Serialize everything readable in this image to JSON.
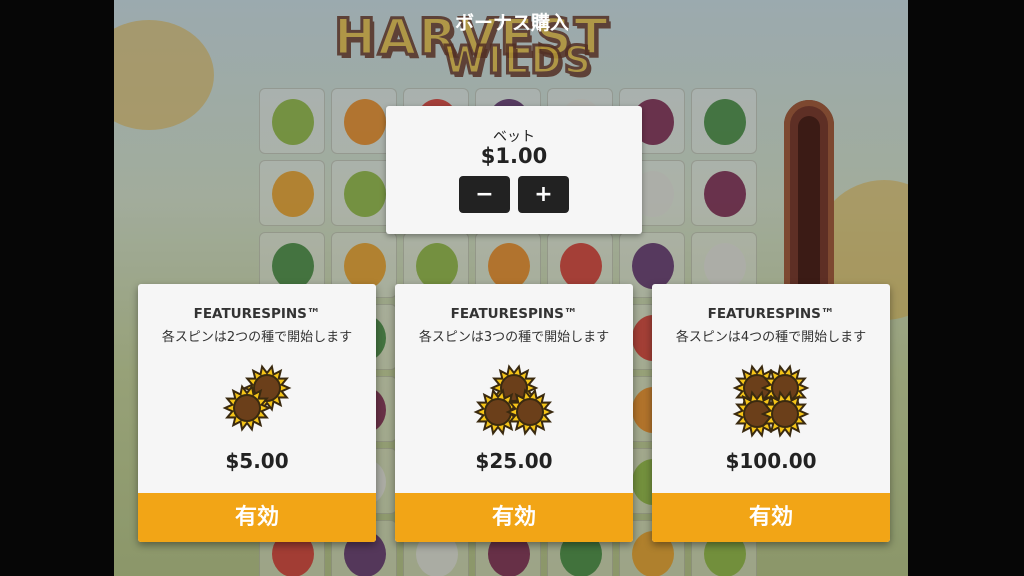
{
  "header": {
    "title": "ボーナス購入"
  },
  "game": {
    "logo_line1": "HARVEST",
    "logo_line2": "WILDS"
  },
  "bet": {
    "label": "ベット",
    "value": "$1.00",
    "decrease_label": "−",
    "increase_label": "+"
  },
  "offers": [
    {
      "title": "FEATURESPINS™",
      "description": "各スピンは2つの種で開始します",
      "price": "$5.00",
      "button": "有効",
      "seeds": 2
    },
    {
      "title": "FEATURESPINS™",
      "description": "各スピンは3つの種で開始します",
      "price": "$25.00",
      "button": "有効",
      "seeds": 3
    },
    {
      "title": "FEATURESPINS™",
      "description": "各スピンは4つの種で開始します",
      "price": "$100.00",
      "button": "有効",
      "seeds": 4
    }
  ],
  "colors": {
    "button": "#f2a516",
    "panel": "#f6f6f6",
    "stepper": "#222222",
    "sunflower_petal": "#f5c518",
    "sunflower_center": "#6b3f1a"
  }
}
